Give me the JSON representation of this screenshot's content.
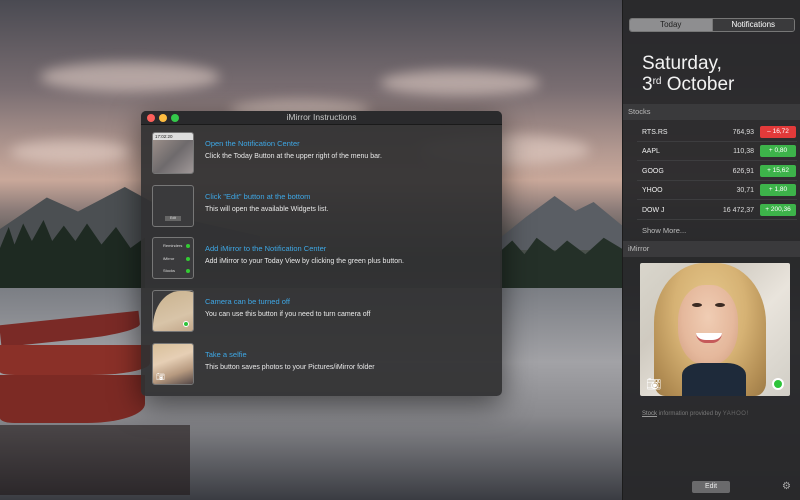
{
  "window": {
    "title": "iMirror Instructions",
    "steps": [
      {
        "title": "Open the Notification Center",
        "description": "Click the Today Button at the upper right of the menu bar.",
        "thumb_text": "17:02:20"
      },
      {
        "title": "Click \"Edit\" button at the bottom",
        "description": "This will open the available Widgets list.",
        "thumb_text": "Edit"
      },
      {
        "title": "Add iMirror to the Notification Center",
        "description": "Add iMirror to your Today View by clicking the green plus button.",
        "thumb_rows": [
          "Reminders",
          "iMirror",
          "Stocks"
        ]
      },
      {
        "title": "Camera can be turned off",
        "description": "You can use this button if you need to turn camera off"
      },
      {
        "title": "Take a selfie",
        "description": "This button saves photos to your Pictures/iMirror folder"
      }
    ]
  },
  "notification_center": {
    "tabs": {
      "today": "Today",
      "notifications": "Notifications"
    },
    "date_line1": "Saturday,",
    "date_day": "3",
    "date_suffix": "rd",
    "date_month": " October",
    "stocks_header": "Stocks",
    "stocks": [
      {
        "symbol": "RTS.RS",
        "price": "764,93",
        "change": "– 16,72",
        "direction": "down"
      },
      {
        "symbol": "AAPL",
        "price": "110,38",
        "change": "+ 0,80",
        "direction": "up"
      },
      {
        "symbol": "GOOG",
        "price": "626,91",
        "change": "+ 15,62",
        "direction": "up"
      },
      {
        "symbol": "YHOO",
        "price": "30,71",
        "change": "+ 1,80",
        "direction": "up"
      },
      {
        "symbol": "DOW J",
        "price": "16 472,37",
        "change": "+ 200,36",
        "direction": "up"
      }
    ],
    "show_more": "Show More...",
    "imirror_header": "iMirror",
    "credit_link": "Stock",
    "credit_text": " information provided by ",
    "credit_brand": "YAHOO!",
    "edit_label": "Edit",
    "colors": {
      "up": "#3db34a",
      "down": "#e23a3a",
      "link": "#3ea8e6"
    }
  }
}
